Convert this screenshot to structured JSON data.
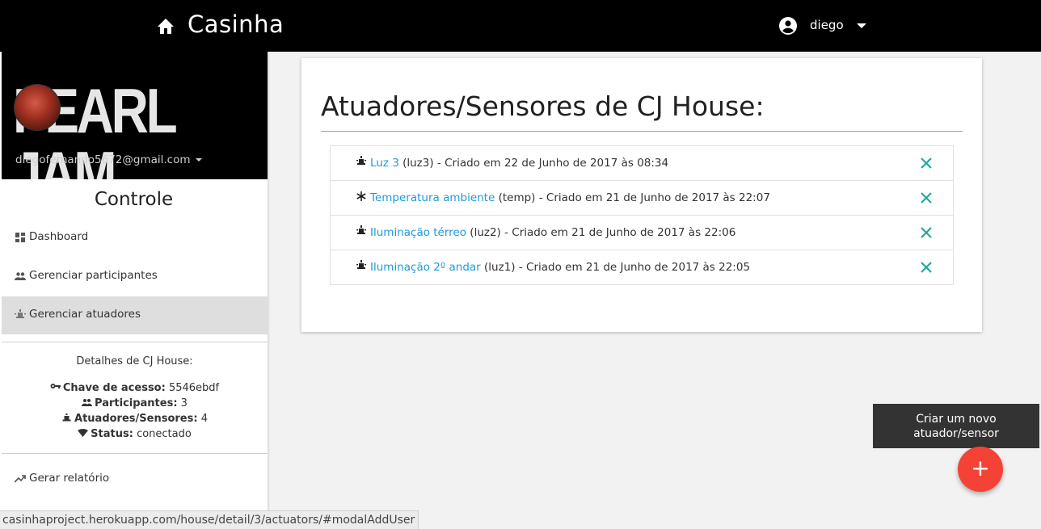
{
  "topbar": {
    "brand": "Casinha",
    "user": "diego"
  },
  "sidebar": {
    "banner_logo": "PEARL JAM",
    "email": "diegofernando5672@gmail.com",
    "section_title": "Controle",
    "items": [
      {
        "label": "Dashboard",
        "icon": "dashboard-icon"
      },
      {
        "label": "Gerenciar participantes",
        "icon": "people-icon"
      },
      {
        "label": "Gerenciar atuadores",
        "icon": "lightbulb-icon",
        "active": true
      },
      {
        "label": "Gerar relatório",
        "icon": "trending-up-icon"
      }
    ],
    "details": {
      "title": "Detalhes de CJ House:",
      "access_key_label": "Chave de acesso:",
      "access_key": "5546ebdf",
      "participants_label": "Participantes:",
      "participants": "3",
      "actuators_label": "Atuadores/Sensores:",
      "actuators": "4",
      "status_label": "Status:",
      "status": "conectado"
    }
  },
  "main": {
    "title": "Atuadores/Sensores de CJ House:",
    "actuators": [
      {
        "name": "Luz 3",
        "id": "(luz3)",
        "created": " - Criado em 22 de Junho de 2017 às 08:34",
        "icon": "lightbulb-icon"
      },
      {
        "name": "Temperatura ambiente",
        "id": "(temp)",
        "created": " - Criado em 21 de Junho de 2017 às 22:07",
        "icon": "snowflake-icon"
      },
      {
        "name": "Iluminação térreo",
        "id": "(luz2)",
        "created": " - Criado em 21 de Junho de 2017 às 22:06",
        "icon": "lightbulb-icon"
      },
      {
        "name": "Iluminação 2º andar",
        "id": "(luz1)",
        "created": " - Criado em 21 de Junho de 2017 às 22:05",
        "icon": "lightbulb-icon"
      }
    ]
  },
  "fab": {
    "tooltip_line1": "Criar um novo",
    "tooltip_line2": "atuador/sensor",
    "label": "+"
  },
  "statusbar": {
    "url": "casinhaproject.herokuapp.com/house/detail/3/actuators/#modalAddUser"
  },
  "colors": {
    "topbar": "#000000",
    "link": "#1e9bd7",
    "delete": "#26a69a",
    "fab": "#f44336",
    "active_nav": "#dedede"
  }
}
